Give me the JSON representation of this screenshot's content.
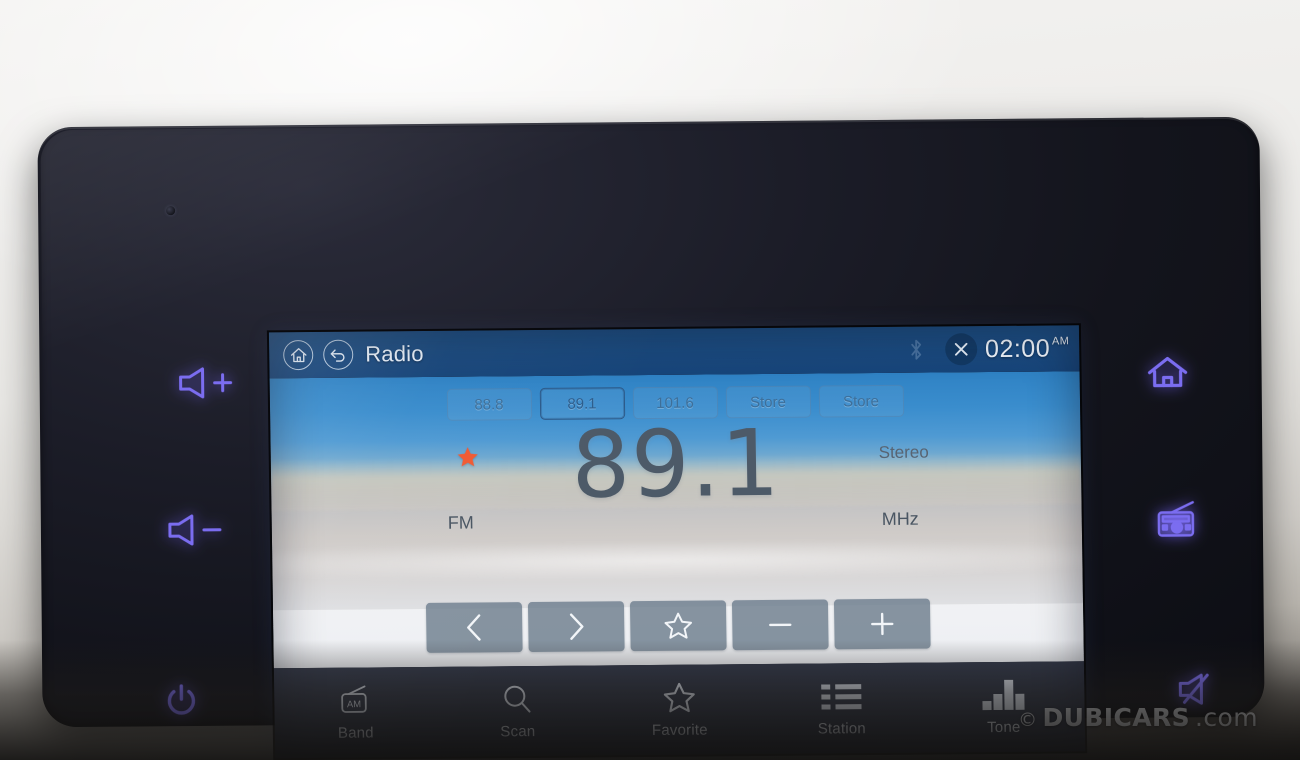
{
  "device": {
    "name": "car-infotainment-head-unit",
    "hardware_keys": [
      {
        "id": "volume-up",
        "icon": "volume-up-icon",
        "label": "Volume Up"
      },
      {
        "id": "volume-down",
        "icon": "volume-down-icon",
        "label": "Volume Down"
      },
      {
        "id": "power",
        "icon": "power-icon",
        "label": "Power"
      },
      {
        "id": "home",
        "icon": "home-icon",
        "label": "Home"
      },
      {
        "id": "radio",
        "icon": "radio-icon",
        "label": "Radio"
      },
      {
        "id": "mute",
        "icon": "mute-icon",
        "label": "Mute"
      }
    ]
  },
  "title_bar": {
    "home_icon": "home-icon",
    "back_icon": "back-arrow-icon",
    "title": "Radio",
    "bluetooth_icon": "bluetooth-icon",
    "close_icon": "close-icon",
    "time": "02:00",
    "meridiem": "AM"
  },
  "presets": [
    {
      "label": "88.8",
      "active": false
    },
    {
      "label": "89.1",
      "active": true
    },
    {
      "label": "101.6",
      "active": false
    },
    {
      "label": "Store",
      "active": false
    },
    {
      "label": "Store",
      "active": false
    }
  ],
  "tuner": {
    "band": "FM",
    "frequency": "89.1",
    "unit": "MHz",
    "stereo": "Stereo",
    "favorite_icon": "star-filled-icon",
    "favorite_color": "#f05a33"
  },
  "controls": [
    {
      "id": "previous",
      "icon": "chevron-left-icon",
      "label": "Previous Station"
    },
    {
      "id": "next",
      "icon": "chevron-right-icon",
      "label": "Next Station"
    },
    {
      "id": "favorite",
      "icon": "star-outline-icon",
      "label": "Add Favorite"
    },
    {
      "id": "minus",
      "icon": "minus-icon",
      "label": "Tune Down"
    },
    {
      "id": "plus",
      "icon": "plus-icon",
      "label": "Tune Up"
    }
  ],
  "bottom_nav": [
    {
      "label": "Band",
      "icon": "radio-am-icon"
    },
    {
      "label": "Scan",
      "icon": "search-icon"
    },
    {
      "label": "Favorite",
      "icon": "star-outline-icon"
    },
    {
      "label": "Station",
      "icon": "list-icon"
    },
    {
      "label": "Tone",
      "icon": "equalizer-icon"
    }
  ],
  "watermark": {
    "copyright": "©",
    "brand": "DUBICARS",
    "suffix": ".com"
  },
  "colors": {
    "title_bar": "#1b4b80",
    "bottom_nav": "#2d3343",
    "accent_orange": "#f05a33",
    "key_backlight": "#7b6df0",
    "control_button": "#6e7e8e"
  }
}
